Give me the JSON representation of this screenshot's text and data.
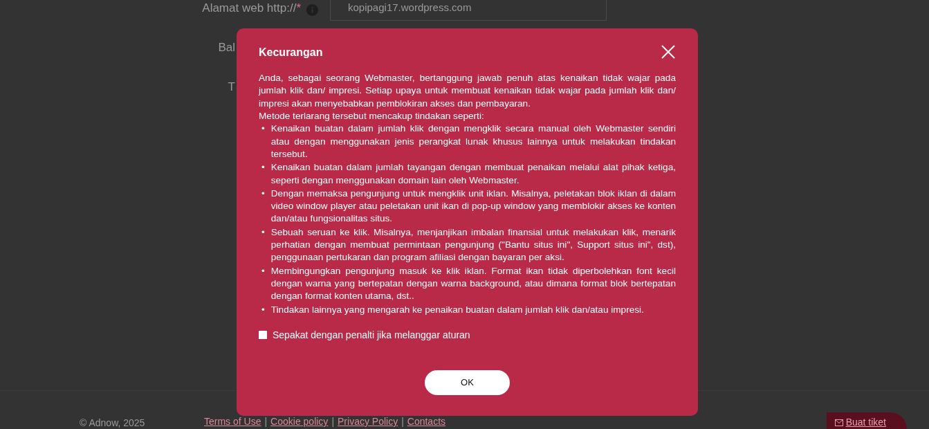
{
  "form": {
    "fields": [
      {
        "label": "Alamat web http://",
        "required_mark": "*",
        "value": "kopipagi17.wordpress.com"
      },
      {
        "label": "Bal"
      },
      {
        "label": "T"
      }
    ]
  },
  "modal": {
    "title": "Kecurangan",
    "intro": "Anda, sebagai seorang Webmaster, bertanggung jawab penuh atas kenaikan tidak wajar pada jumlah klik dan/ impresi. Setiap upaya untuk membuat kenaikan tidak wajar pada jumlah klik dan/ impresi akan menyebabkan pemblokiran akses dan pembayaran.",
    "methods_heading": "Metode terlarang tersebut mencakup tindakan seperti:",
    "bullet": "•",
    "methods": [
      "Kenaikan buatan dalam jumlah klik dengan mengklik secara manual oleh Webmaster sendiri atau dengan menggunakan jenis perangkat lunak khusus lainnya untuk melakukan tindakan tersebut.",
      "Kenaikan buatan dalam jumlah tayangan dengan membuat penaikan melalui alat pihak ketiga, seperti dengan menggunakan domain lain oleh Webmaster.",
      "Dengan memaksa pengunjung untuk mengklik unit iklan. Misalnya, peletakan blok iklan di dalam video window player atau peletakan unit ikan di pop-up window yang memblokir akses ke konten dan/atau fungsionalitas situs.",
      "Sebuah seruan ke klik. Misalnya, menjanjikan imbalan finansial untuk melakukan klik, menarik perhatian dengan membuat permintaan pengunjung (\"Bantu situs ini\", Support situs ini\", dst), penggunaan pertukaran dan program afiliasi dengan bayaran per aksi.",
      "Membingungkan pengunjung masuk ke klik iklan. Format ikan tidak diperbolehkan font kecil dengan warna yang bertepatan dengan warna background, atau dimana format blok bertepatan dengan format konten utama, dst..",
      "Tindakan lainnya yang mengarah ke penaikan buatan dalam jumlah klik dan/atau impresi."
    ],
    "agreement": {
      "label": "Sepakat dengan penalti jika melanggar aturan",
      "checked": false
    },
    "ok_button": "OK"
  },
  "footer": {
    "copyright": "© Adnow, 2025",
    "links": [
      "Terms of Use",
      "Cookie policy",
      "Privacy Policy",
      "Contacts"
    ],
    "separator": "|",
    "ticket_button": "Buat tiket"
  }
}
